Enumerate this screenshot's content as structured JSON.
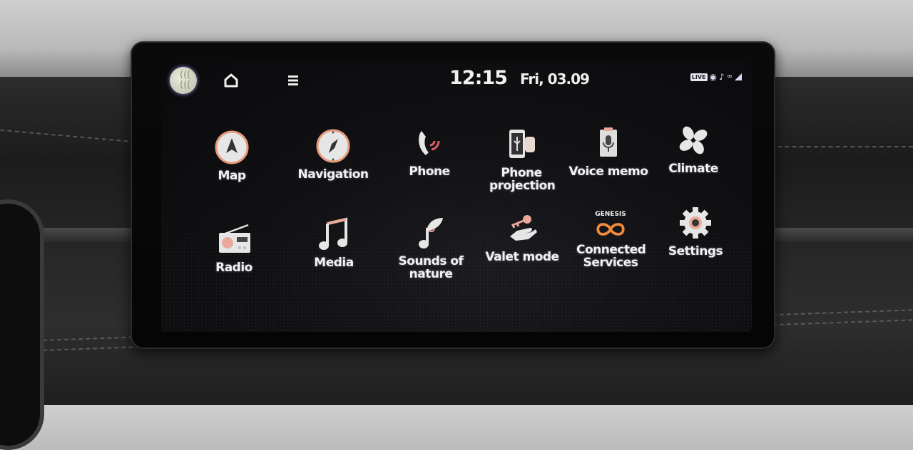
{
  "status_bar": {
    "time": "12:15",
    "date": "Fri, 03.09",
    "live_badge": "LIVE",
    "icons": [
      "profile-avatar",
      "home-icon",
      "menu-icon",
      "live-badge",
      "bluetooth-audio-icon",
      "music-note-icon",
      "connected-link-icon",
      "signal-icon"
    ]
  },
  "apps": [
    {
      "label": "Map",
      "icon": "map-icon"
    },
    {
      "label": "Navigation",
      "icon": "compass-icon"
    },
    {
      "label": "Phone",
      "icon": "phone-icon"
    },
    {
      "label": "Phone projection",
      "icon": "phone-projection-icon"
    },
    {
      "label": "Voice memo",
      "icon": "voice-memo-icon"
    },
    {
      "label": "Climate",
      "icon": "fan-icon"
    },
    {
      "label": "Radio",
      "icon": "radio-icon"
    },
    {
      "label": "Media",
      "icon": "music-note-icon"
    },
    {
      "label": "Sounds of nature",
      "icon": "leaf-note-icon"
    },
    {
      "label": "Valet mode",
      "icon": "key-hand-icon"
    },
    {
      "label": "Connected Services",
      "icon": "genesis-connected-icon",
      "brand": "GENESIS"
    },
    {
      "label": "Settings",
      "icon": "gear-icon"
    }
  ],
  "colors": {
    "accent": "#f08a3c",
    "icon_fill": "#e8e8e8",
    "icon_ring": "#e8a08a",
    "screen_bg": "#0d0d10",
    "text": "#f2f2f2"
  }
}
